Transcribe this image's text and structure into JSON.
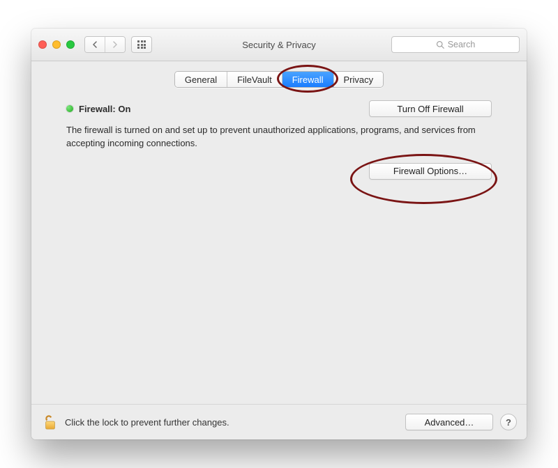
{
  "window": {
    "title": "Security & Privacy"
  },
  "search": {
    "placeholder": "Search"
  },
  "tabs": [
    {
      "label": "General"
    },
    {
      "label": "FileVault"
    },
    {
      "label": "Firewall",
      "selected": true
    },
    {
      "label": "Privacy"
    }
  ],
  "firewall": {
    "status_label": "Firewall: On",
    "turn_off_label": "Turn Off Firewall",
    "description": "The firewall is turned on and set up to prevent unauthorized applications, programs, and services from accepting incoming connections.",
    "options_label": "Firewall Options…"
  },
  "footer": {
    "lock_text": "Click the lock to prevent further changes.",
    "advanced_label": "Advanced…"
  }
}
